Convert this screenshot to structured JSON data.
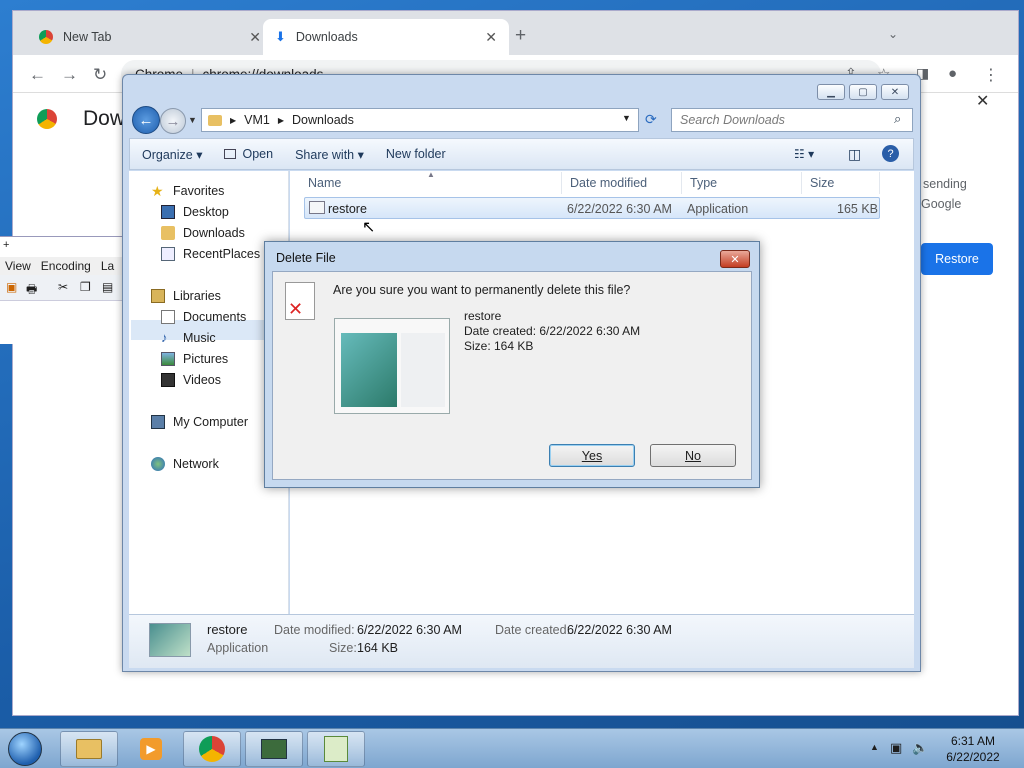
{
  "chrome": {
    "tabs": [
      {
        "label": "New Tab",
        "icon": "chrome-icon"
      },
      {
        "label": "Downloads",
        "icon": "download-icon"
      }
    ],
    "omnibox": {
      "site": "Chrome",
      "url": "chrome://downloads"
    },
    "page_title": "Downloads",
    "side_text_1": "sending",
    "side_text_2": "Google",
    "restore_label": "Restore"
  },
  "notepad": {
    "menu": [
      "View",
      "Encoding",
      "La"
    ]
  },
  "explorer": {
    "breadcrumb": [
      "VM1",
      "Downloads"
    ],
    "search_placeholder": "Search Downloads",
    "commands": {
      "organize": "Organize",
      "open": "Open",
      "share": "Share with",
      "new_folder": "New folder"
    },
    "nav": {
      "favorites": "Favorites",
      "desktop": "Desktop",
      "downloads": "Downloads",
      "recent": "RecentPlaces",
      "libraries": "Libraries",
      "documents": "Documents",
      "music": "Music",
      "pictures": "Pictures",
      "videos": "Videos",
      "computer": "My Computer",
      "network": "Network"
    },
    "columns": {
      "name": "Name",
      "date": "Date modified",
      "type": "Type",
      "size": "Size"
    },
    "files": [
      {
        "name": "restore",
        "date": "6/22/2022 6:30 AM",
        "type": "Application",
        "size": "165 KB"
      }
    ],
    "details": {
      "name": "restore",
      "type": "Application",
      "date_modified_label": "Date modified:",
      "date_modified": "6/22/2022 6:30 AM",
      "date_created_label": "Date created:",
      "date_created": "6/22/2022 6:30 AM",
      "size_label": "Size:",
      "size": "164 KB"
    }
  },
  "dialog": {
    "title": "Delete File",
    "question": "Are you sure you want to permanently delete this file?",
    "file_name": "restore",
    "date_created": "Date created: 6/22/2022 6:30 AM",
    "size": "Size: 164 KB",
    "yes": "Yes",
    "no": "No"
  },
  "taskbar": {
    "time": "6:31 AM",
    "date": "6/22/2022"
  },
  "colors": {
    "accent": "#1a73e8",
    "taskbar": "#8fb3d9",
    "dialog_frame": "#c6d9ef"
  }
}
